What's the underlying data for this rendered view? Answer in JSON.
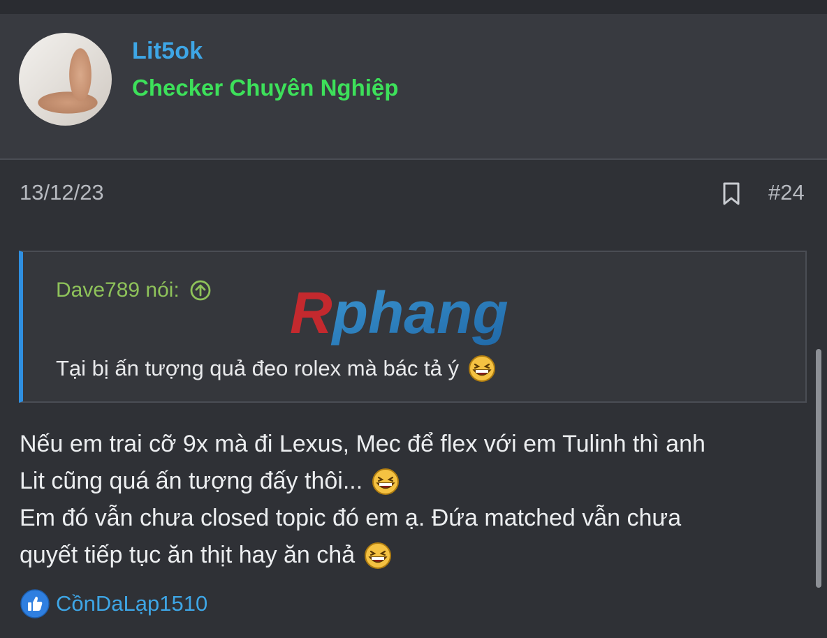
{
  "colors": {
    "username": "#3ea6e6",
    "user_title": "#3de05a",
    "quote_attribution": "#8ec25a",
    "quote_border": "#2f8fe0",
    "background": "#2f3136"
  },
  "user": {
    "name": "Lit5ok",
    "title": "Checker Chuyên Nghiệp"
  },
  "post": {
    "date": "13/12/23",
    "number": "#24",
    "bookmark_icon": "bookmark-icon"
  },
  "quote": {
    "attribution": "Dave789 nói:",
    "attribution_icon": "arrow-up-circle-icon",
    "text": "Tại bị ấn tượng quả đeo rolex mà bác tả ý"
  },
  "watermark": {
    "text": "Rphang"
  },
  "body": {
    "lines": [
      "Nếu em trai cỡ 9x mà đi Lexus, Mec để flex với em Tulinh thì anh",
      "Lit cũng quá ấn tượng đấy thôi...",
      "Em đó vẫn chưa closed topic đó em ạ. Đứa matched vẫn chưa",
      "quyết tiếp tục ăn thịt hay ăn chả"
    ]
  },
  "reactions": {
    "icon": "like-icon",
    "user": "CồnDaLạp1510"
  }
}
